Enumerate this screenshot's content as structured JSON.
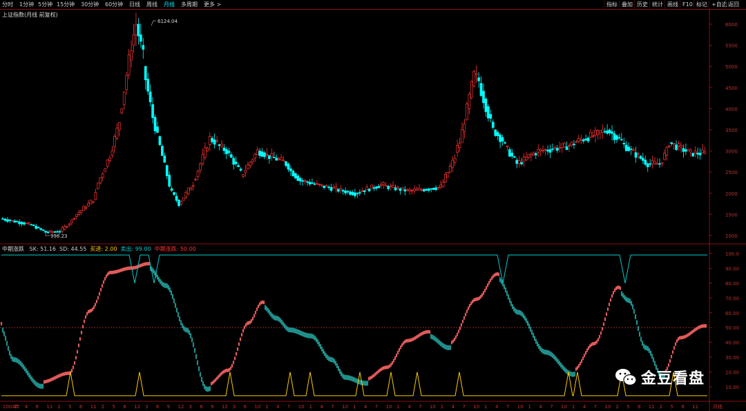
{
  "toolbar": {
    "timeframes": [
      {
        "label": "分时"
      },
      {
        "label": "1分钟"
      },
      {
        "label": "5分钟"
      },
      {
        "label": "15分钟"
      },
      {
        "label": "30分钟"
      },
      {
        "label": "60分钟"
      },
      {
        "label": "日线"
      },
      {
        "label": "周线"
      },
      {
        "label": "月线",
        "active": true
      },
      {
        "label": "多周期"
      },
      {
        "label": "更多 >"
      }
    ],
    "right_buttons": [
      "指标",
      "叠加",
      "历史",
      "统计",
      "画线",
      "F10",
      "标记",
      "+自选",
      "返回"
    ]
  },
  "main_chart": {
    "title": "上证指数(月线 前复权)",
    "high_label": "6124.04",
    "low_label": "998.23",
    "price_axis": [
      "6000",
      "5500",
      "5000",
      "4500",
      "4000",
      "3500",
      "3000",
      "2500",
      "2000",
      "1500",
      "1000"
    ],
    "up_color": "#ff3333",
    "down_color": "#00ffff"
  },
  "indicator": {
    "name": "中期涨跌",
    "values": [
      {
        "label": "SK",
        "value": "51.16",
        "color": "#cccccc"
      },
      {
        "label": "SD",
        "value": "44.55",
        "color": "#cccccc"
      },
      {
        "label": "买进",
        "value": "2.00",
        "color": "#ffcc00"
      },
      {
        "label": "卖出",
        "value": "99.00",
        "color": "#00cccc"
      },
      {
        "label": "中期涨跌",
        "value": "50.00",
        "color": "#ff3333"
      }
    ],
    "axis": [
      "100.0",
      "90.00",
      "80.00",
      "70.00",
      "60.00",
      "50.00",
      "40.00",
      "30.00",
      "20.00",
      "10.00"
    ],
    "bull_color": "#e05a5a",
    "bear_color": "#1f8f8a"
  },
  "x_axis": {
    "labels": [
      "2004年",
      "1",
      "4",
      "8",
      "11",
      "2",
      "5",
      "8",
      "11",
      "2",
      "5",
      "8",
      "12",
      "3",
      "6",
      "9",
      "12",
      "3",
      "6",
      "9",
      "12",
      "3",
      "6",
      "10",
      "1",
      "4",
      "7",
      "10",
      "1",
      "4",
      "7",
      "10",
      "1",
      "4",
      "7",
      "10",
      "1",
      "4",
      "7",
      "10",
      "1",
      "4",
      "7",
      "10",
      "1",
      "4",
      "7",
      "10",
      "1",
      "4",
      "7",
      "10",
      "1",
      "4",
      "7",
      "10",
      "2",
      "5",
      "8",
      "11",
      "2",
      "5",
      "8",
      "11"
    ],
    "period_label": "月线"
  },
  "watermark": {
    "text": "金豆看盘",
    "icon": "wechat-icon"
  }
}
